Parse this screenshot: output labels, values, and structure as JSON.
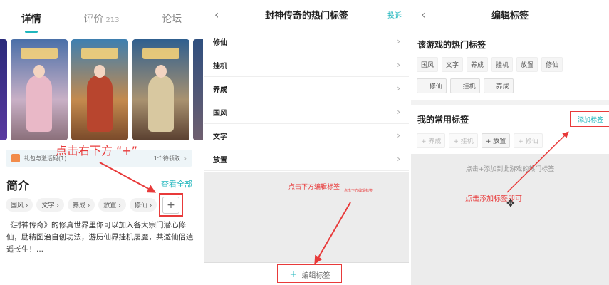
{
  "panel1": {
    "tabs": [
      {
        "label": "详情",
        "count": ""
      },
      {
        "label": "评价",
        "count": "213"
      },
      {
        "label": "论坛",
        "count": ""
      }
    ],
    "screenshot_count": 3,
    "gift_bar": {
      "left": "礼包与激活码(1)",
      "right": "1个待领取"
    },
    "annotation": "点击右下方 “+”",
    "intro_title": "简介",
    "see_all": "查看全部",
    "tags": [
      "国风 ›",
      "文字 ›",
      "养成 ›",
      "放置 ›",
      "修仙 ›"
    ],
    "plus": "+",
    "description": "《封神传奇》的修真世界里你可以加入各大宗门潜心修仙，励精图治自创功法，游历仙界挂机屠魔，共邀仙侣逍遥长生！..."
  },
  "panel2": {
    "title": "封神传奇的热门标签",
    "report": "投诉",
    "back": "‹",
    "items": [
      "修仙",
      "挂机",
      "养成",
      "国风",
      "文字",
      "放置"
    ],
    "annotation_main": "点击下方编辑标签",
    "annotation_small": "点击下方编辑标签",
    "edit_button": "编辑标签",
    "edit_plus": "+"
  },
  "panel3": {
    "title": "编辑标签",
    "back": "‹",
    "hot_title": "该游戏的热门标签",
    "hot_tags": [
      "国风",
      "文字",
      "养成",
      "挂机",
      "放置",
      "修仙"
    ],
    "removable_tags": [
      "一 修仙",
      "一 挂机",
      "一 养成"
    ],
    "my_title": "我的常用标签",
    "add_button": "添加标签",
    "my_tags": [
      {
        "label": "+ 养成",
        "muted": true
      },
      {
        "label": "+ 挂机",
        "muted": true
      },
      {
        "label": "+ 放置",
        "muted": false
      },
      {
        "label": "+ 修仙",
        "muted": true
      }
    ],
    "hint": "点击+添加到此游戏的热门标签",
    "annotation": "点击添加标签即可",
    "cursor": "✥"
  },
  "colors": {
    "accent": "#1fb6bd",
    "annotation": "#e83a3a"
  }
}
